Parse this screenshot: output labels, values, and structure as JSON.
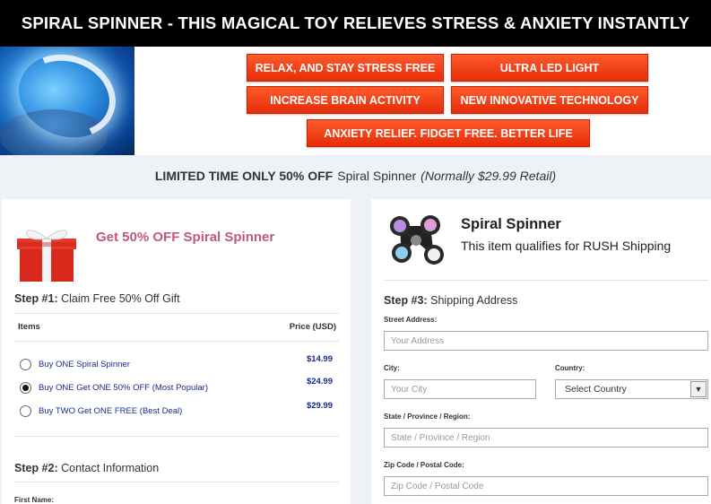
{
  "header": {
    "title": "SPIRAL SPINNER - THIS MAGICAL TOY RELIEVES STRESS & ANXIETY INSTANTLY"
  },
  "badges": [
    "RELAX, AND STAY STRESS FREE",
    "ULTRA LED LIGHT",
    "INCREASE BRAIN ACTIVITY",
    "NEW INNOVATIVE TECHNOLOGY",
    "ANXIETY RELIEF. FIDGET FREE. BETTER LIFE"
  ],
  "promo": {
    "bold": "LIMITED TIME ONLY 50% OFF",
    "product": "Spiral Spinner",
    "italic": "(Normally $29.99 Retail)"
  },
  "left": {
    "gift_title": "Get 50% OFF Spiral Spinner",
    "step1": {
      "label": "Step #1:",
      "text": "Claim Free 50% Off Gift"
    },
    "table": {
      "col_items": "Items",
      "col_price": "Price (USD)"
    },
    "options": [
      {
        "label": "Buy ONE Spiral Spinner",
        "price": "$14.99",
        "selected": false
      },
      {
        "label": "Buy ONE Get ONE 50% OFF (Most Popular)",
        "price": "$24.99",
        "selected": true
      },
      {
        "label": "Buy TWO Get ONE FREE (Best Deal)",
        "price": "$29.99",
        "selected": false
      }
    ],
    "step2": {
      "label": "Step #2:",
      "text": "Contact Information"
    },
    "first_name_label": "First Name:"
  },
  "right": {
    "product_title": "Spiral Spinner",
    "product_sub": "This item qualifies for RUSH Shipping",
    "step3": {
      "label": "Step #3:",
      "text": "Shipping Address"
    },
    "street": {
      "label": "Street Address:",
      "placeholder": "Your Address"
    },
    "city": {
      "label": "City:",
      "placeholder": "Your City"
    },
    "country": {
      "label": "Country:",
      "value": "Select Country"
    },
    "state": {
      "label": "State / Province / Region:",
      "placeholder": "State / Province / Region"
    },
    "zip": {
      "label": "Zip Code / Postal Code:",
      "placeholder": "Zip Code / Postal Code"
    }
  },
  "colors": {
    "badge": "#e62d0a",
    "gift_title": "#c0587a",
    "option_text": "#1a2a8a"
  }
}
